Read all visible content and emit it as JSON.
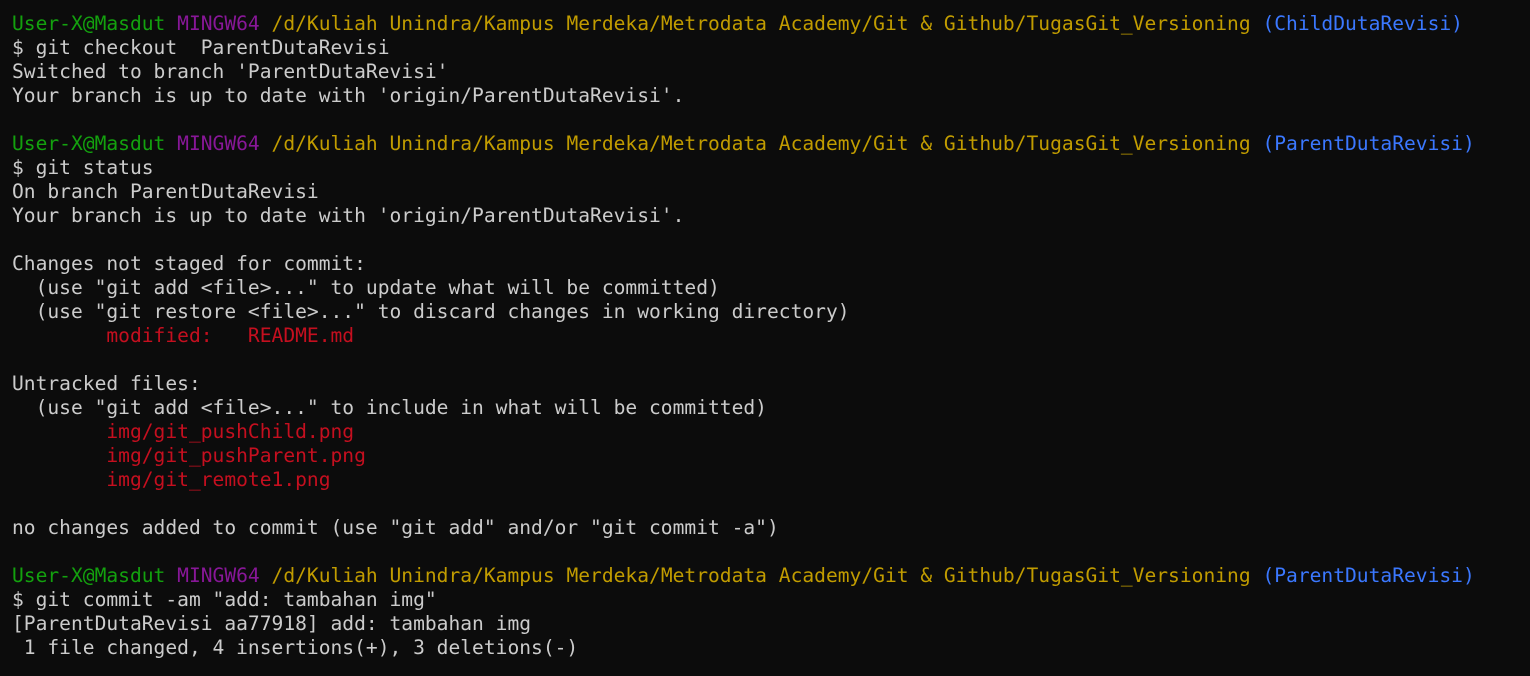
{
  "colors": {
    "background": "#0c0c0c",
    "foreground": "#cccccc",
    "user": "#13a10e",
    "host": "#881798",
    "path": "#c19c00",
    "branch": "#3b78ff",
    "red": "#c50f1f"
  },
  "blocks": [
    {
      "prompt": {
        "user": "User-X@Masdut",
        "host": "MINGW64",
        "path": "/d/Kuliah Unindra/Kampus Merdeka/Metrodata Academy/Git & Github/TugasGit_Versioning",
        "branch": "(ChildDutaRevisi)"
      },
      "command": "$ git checkout  ParentDutaRevisi",
      "output": [
        {
          "text": "Switched to branch 'ParentDutaRevisi'",
          "color": "normal"
        },
        {
          "text": "Your branch is up to date with 'origin/ParentDutaRevisi'.",
          "color": "normal"
        },
        {
          "text": "",
          "color": "normal"
        }
      ]
    },
    {
      "prompt": {
        "user": "User-X@Masdut",
        "host": "MINGW64",
        "path": "/d/Kuliah Unindra/Kampus Merdeka/Metrodata Academy/Git & Github/TugasGit_Versioning",
        "branch": "(ParentDutaRevisi)"
      },
      "command": "$ git status",
      "output": [
        {
          "text": "On branch ParentDutaRevisi",
          "color": "normal"
        },
        {
          "text": "Your branch is up to date with 'origin/ParentDutaRevisi'.",
          "color": "normal"
        },
        {
          "text": "",
          "color": "normal"
        },
        {
          "text": "Changes not staged for commit:",
          "color": "normal"
        },
        {
          "text": "  (use \"git add <file>...\" to update what will be committed)",
          "color": "normal"
        },
        {
          "text": "  (use \"git restore <file>...\" to discard changes in working directory)",
          "color": "normal"
        },
        {
          "text": "        modified:   README.md",
          "color": "red"
        },
        {
          "text": "",
          "color": "normal"
        },
        {
          "text": "Untracked files:",
          "color": "normal"
        },
        {
          "text": "  (use \"git add <file>...\" to include in what will be committed)",
          "color": "normal"
        },
        {
          "text": "        img/git_pushChild.png",
          "color": "red"
        },
        {
          "text": "        img/git_pushParent.png",
          "color": "red"
        },
        {
          "text": "        img/git_remote1.png",
          "color": "red"
        },
        {
          "text": "",
          "color": "normal"
        },
        {
          "text": "no changes added to commit (use \"git add\" and/or \"git commit -a\")",
          "color": "normal"
        },
        {
          "text": "",
          "color": "normal"
        }
      ]
    },
    {
      "prompt": {
        "user": "User-X@Masdut",
        "host": "MINGW64",
        "path": "/d/Kuliah Unindra/Kampus Merdeka/Metrodata Academy/Git & Github/TugasGit_Versioning",
        "branch": "(ParentDutaRevisi)"
      },
      "command": "$ git commit -am \"add: tambahan img\"",
      "output": [
        {
          "text": "[ParentDutaRevisi aa77918] add: tambahan img",
          "color": "normal"
        },
        {
          "text": " 1 file changed, 4 insertions(+), 3 deletions(-)",
          "color": "normal"
        }
      ]
    }
  ]
}
